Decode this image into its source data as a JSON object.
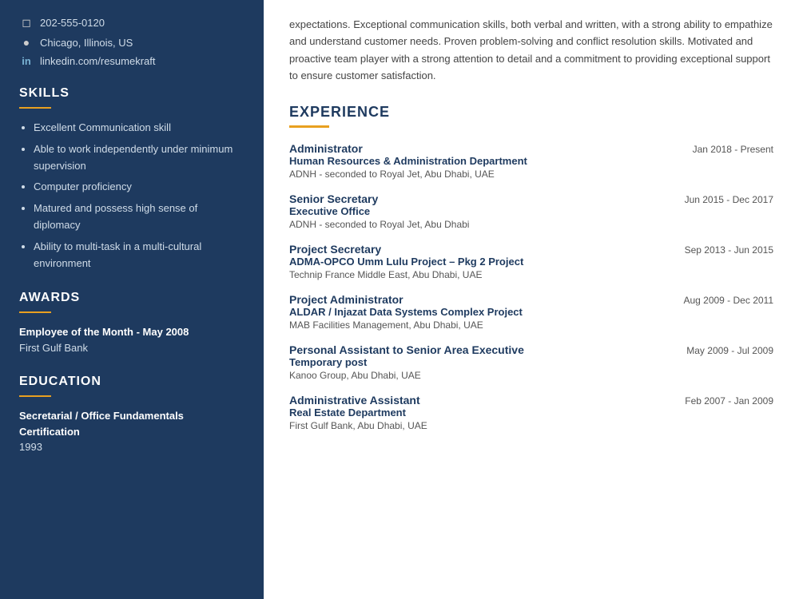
{
  "sidebar": {
    "contact": {
      "phone": "202-555-0120",
      "location": "Chicago, Illinois, US",
      "linkedin": "linkedin.com/resumekraft"
    },
    "skills_title": "SKILLS",
    "skills": [
      "Excellent Communication skill",
      "Able to work independently under minimum supervision",
      "Computer proficiency",
      "Matured and possess high sense of diplomacy",
      "Ability to multi-task in a multi-cultural environment"
    ],
    "awards_title": "AWARDS",
    "award_name": "Employee of the Month - May 2008",
    "award_org": "First Gulf Bank",
    "education_title": "EDUCATION",
    "edu_degree": "Secretarial / Office Fundamentals Certification",
    "edu_year": "1993"
  },
  "main": {
    "summary": "expectations. Exceptional communication skills, both verbal and written, with a strong ability to empathize and understand customer needs. Proven problem-solving and conflict resolution skills. Motivated and proactive team player with a strong attention to detail and a commitment to providing exceptional support to ensure customer satisfaction.",
    "experience_title": "EXPERIENCE",
    "experiences": [
      {
        "title": "Administrator",
        "company": "Human Resources & Administration Department",
        "location": "ADNH - seconded to Royal Jet, Abu Dhabi, UAE",
        "date": "Jan 2018 - Present"
      },
      {
        "title": "Senior Secretary",
        "company": "Executive Office",
        "location": "ADNH - seconded to Royal Jet, Abu Dhabi",
        "date": "Jun 2015 - Dec 2017"
      },
      {
        "title": "Project Secretary",
        "company": "ADMA-OPCO Umm Lulu Project – Pkg 2 Project",
        "location": "Technip France Middle East, Abu Dhabi, UAE",
        "date": "Sep 2013 - Jun 2015"
      },
      {
        "title": "Project Administrator",
        "company": "ALDAR / Injazat Data Systems Complex Project",
        "location": "MAB Facilities Management, Abu Dhabi, UAE",
        "date": "Aug 2009 - Dec 2011"
      },
      {
        "title": "Personal Assistant to Senior Area Executive",
        "company": "Temporary post",
        "location": "Kanoo Group, Abu Dhabi, UAE",
        "date": "May 2009 - Jul 2009"
      },
      {
        "title": "Administrative Assistant",
        "company": "Real Estate Department",
        "location": "First Gulf Bank, Abu Dhabi, UAE",
        "date": "Feb 2007 - Jan 2009"
      }
    ]
  },
  "icons": {
    "phone": "☐",
    "location": "📍",
    "linkedin": "in"
  }
}
